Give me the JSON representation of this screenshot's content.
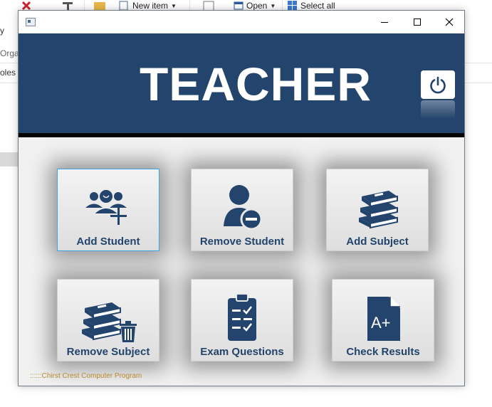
{
  "background": {
    "ribbon": {
      "new_item": "New item",
      "open": "Open",
      "select_all": "Select all"
    },
    "left_labels": [
      "y",
      "Orga",
      "oles"
    ]
  },
  "window": {
    "controls": {
      "minimize": "minimize-icon",
      "maximize": "maximize-icon",
      "close": "close-icon"
    }
  },
  "header": {
    "title": "TEACHER",
    "color": "#23446c"
  },
  "tiles": [
    {
      "label": "Add Student",
      "icon": "add-student-icon"
    },
    {
      "label": "Remove Student",
      "icon": "remove-student-icon"
    },
    {
      "label": "Add Subject",
      "icon": "add-subject-icon"
    },
    {
      "label": "Remove Subject",
      "icon": "remove-subject-icon"
    },
    {
      "label": "Exam Questions",
      "icon": "exam-questions-icon"
    },
    {
      "label": "Check Results",
      "icon": "check-results-icon"
    }
  ],
  "footer": "::::::Chirst Crest Computer Program"
}
